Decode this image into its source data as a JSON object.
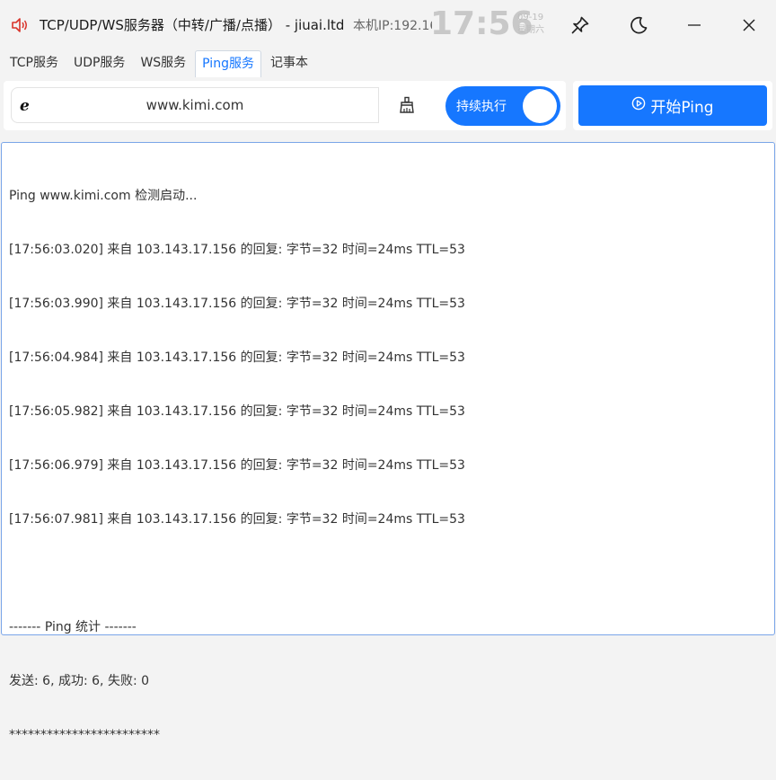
{
  "window": {
    "title": "TCP/UDP/WS服务器（中转/广播/点播） - jiuai.ltd",
    "ip_label": "本机IP:192.168.1",
    "clock": "17:56",
    "date": "09-19",
    "weekday": "星期六",
    "buttons": [
      "pin-icon",
      "moon-icon",
      "minimize-icon",
      "close-icon"
    ]
  },
  "tabs": [
    {
      "label": "TCP服务",
      "active": false
    },
    {
      "label": "UDP服务",
      "active": false
    },
    {
      "label": "WS服务",
      "active": false
    },
    {
      "label": "Ping服务",
      "active": true
    },
    {
      "label": "记事本",
      "active": false
    }
  ],
  "controls": {
    "url_value": "www.kimi.com",
    "continuous_label": "持续执行",
    "continuous_on": true,
    "start_label": "开始Ping"
  },
  "output": {
    "lines": [
      "Ping www.kimi.com 检测启动...",
      "[17:56:03.020] 来自 103.143.17.156 的回复: 字节=32 时间=24ms TTL=53",
      "[17:56:03.990] 来自 103.143.17.156 的回复: 字节=32 时间=24ms TTL=53",
      "[17:56:04.984] 来自 103.143.17.156 的回复: 字节=32 时间=24ms TTL=53",
      "[17:56:05.982] 来自 103.143.17.156 的回复: 字节=32 时间=24ms TTL=53",
      "[17:56:06.979] 来自 103.143.17.156 的回复: 字节=32 时间=24ms TTL=53",
      "[17:56:07.981] 来自 103.143.17.156 的回复: 字节=32 时间=24ms TTL=53",
      "",
      "------- Ping 统计 -------",
      "发送: 6, 成功: 6, 失败: 0",
      "************************"
    ]
  },
  "colors": {
    "accent": "#1677ff",
    "background": "#f3f3f3",
    "clock": "#c8c8c8"
  }
}
